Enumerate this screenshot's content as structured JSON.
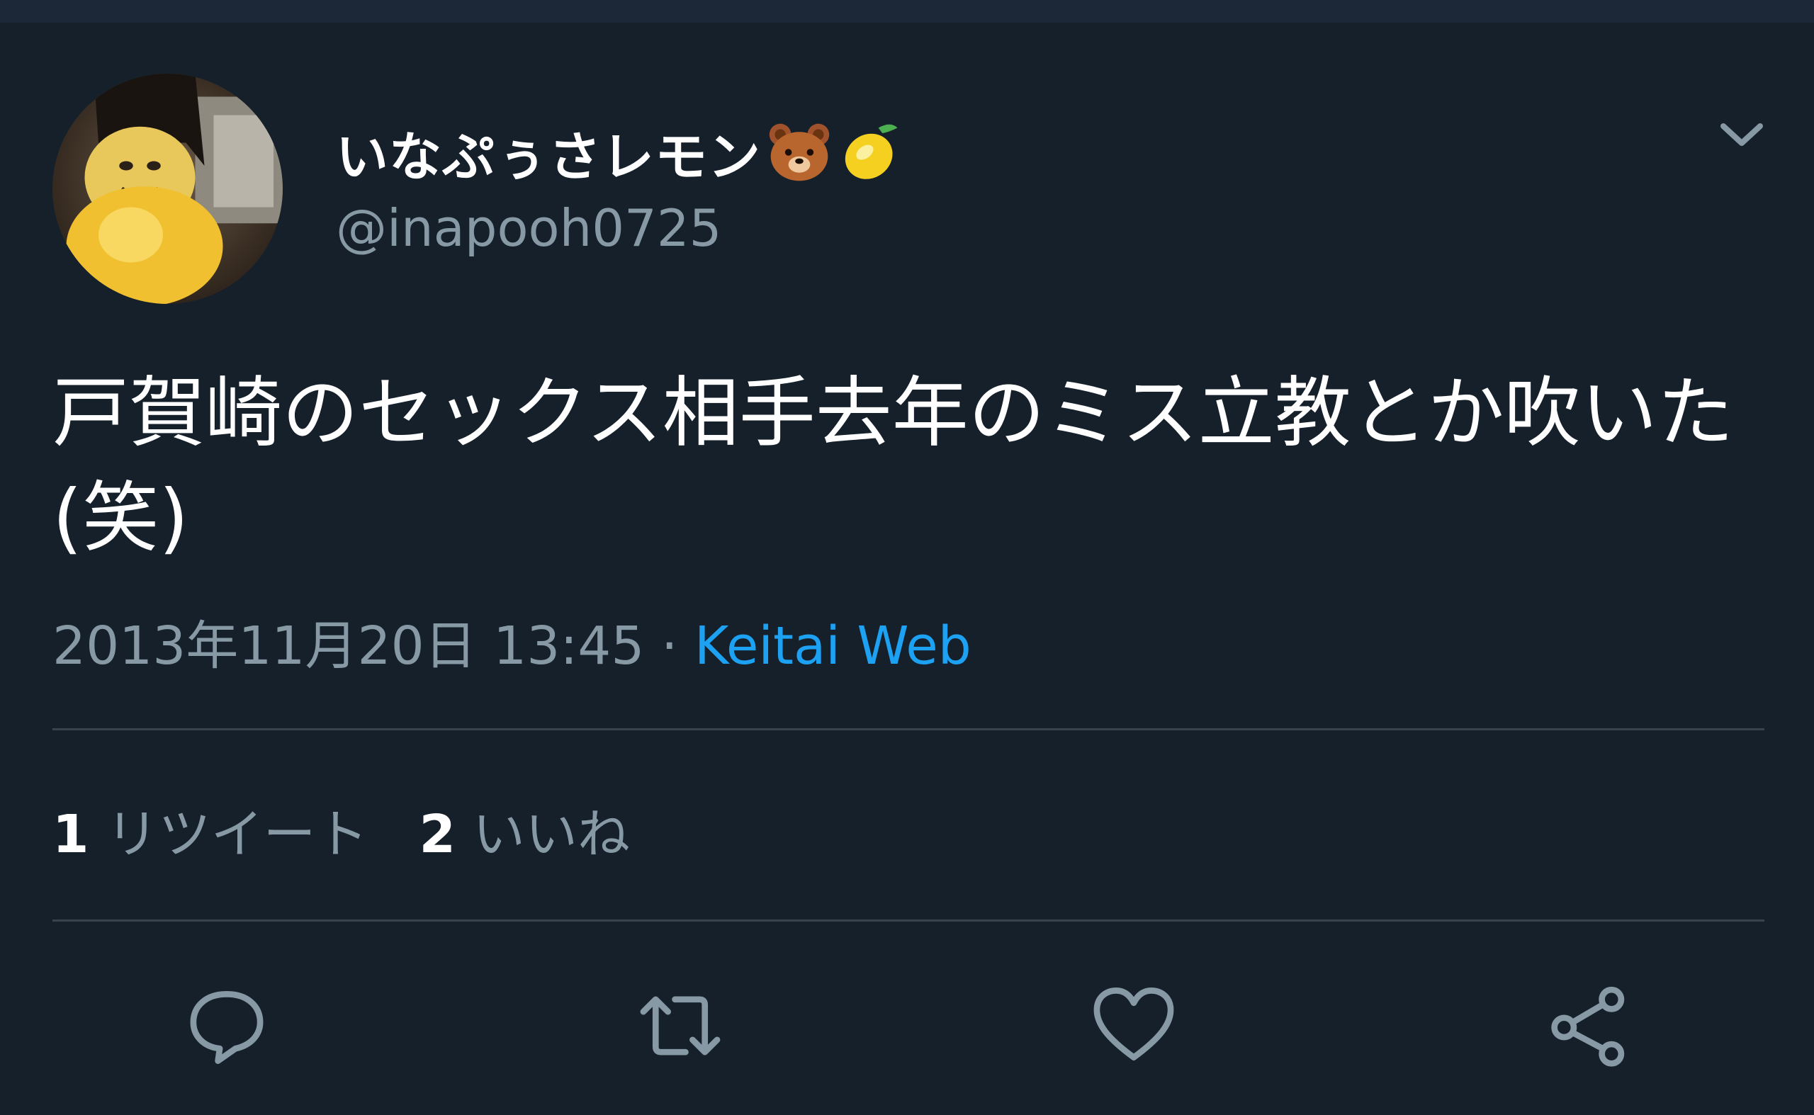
{
  "tweet": {
    "display_name": "いなぷぅさレモン",
    "emojis": [
      "bear-face-emoji",
      "lemon-emoji"
    ],
    "handle": "@inapooh0725",
    "text": "戸賀崎のセックス相手去年のミス立教とか吹いた(笑)",
    "timestamp": "2013年11月20日 13:45",
    "separator": " · ",
    "source": "Keitai Web"
  },
  "stats": {
    "retweet_count": "1",
    "retweet_label": "リツイート",
    "like_count": "2",
    "like_label": "いいね"
  },
  "icons": {
    "menu": "chevron-down-icon",
    "reply": "reply-icon",
    "retweet": "retweet-icon",
    "like": "heart-icon",
    "share": "share-icon"
  },
  "colors": {
    "background": "#15202b",
    "text": "#ffffff",
    "secondary": "#8899a6",
    "accent": "#1da1f2",
    "divider": "#38444d"
  }
}
